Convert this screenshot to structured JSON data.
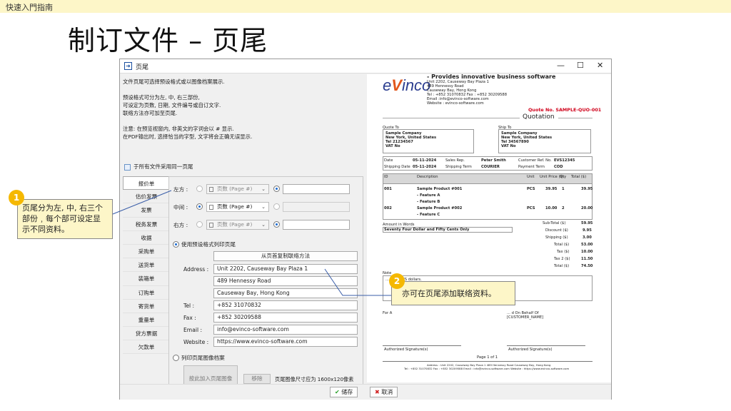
{
  "slide": {
    "header": "快速入門指南",
    "title": "制订文件 – 页尾"
  },
  "window": {
    "title": "页尾",
    "min": "—",
    "max": "☐",
    "close": "✕"
  },
  "notes": [
    "文件页尾可选择预设格式或以图像档案展示.",
    "",
    "预设格式可分为左, 中, 右三部份,",
    "可设定为页数, 日期, 文件编号或自订文字.",
    "联络方法亦可加至页尾.",
    "",
    "注意: 在预览视窗内, 非英文的字词会以 # 显示.",
    "在PDF输出时, 选择恰当的字型, 文字将会正确无误显示."
  ],
  "checkbox": "于所有文件采用同一页尾",
  "tabs": [
    "报价单",
    "估价发票",
    "发票",
    "税务发票",
    "收据",
    "采购单",
    "送货单",
    "装箱单",
    "订购单",
    "寄货单",
    "重量单",
    "贷方票据",
    "欠款单"
  ],
  "sections": {
    "left": "左方 :",
    "center": "中间 :",
    "right": "右方 :",
    "page_placeholder": "页数 (Page #)",
    "use_preset": "使用预设格式列印页尾",
    "copy_btn": "从页首复制联络方法",
    "address_label": "Address :",
    "address": [
      "Unit 2202, Causeway Bay Plaza 1",
      "489 Hennessy Road",
      "Causeway Bay, Hong Kong"
    ],
    "tel_label": "Tel :",
    "tel": "+852 31070832",
    "fax_label": "Fax :",
    "fax": "+852 30209588",
    "email_label": "Email :",
    "email": "info@evinco-software.com",
    "website_label": "Website :",
    "website": "https://www.evinco-software.com",
    "print_image": "列印页尾图像档案",
    "add_image_btn": "按此加入页尾图像",
    "remove_btn": "移除",
    "image_hint": "页尾图像尺寸应为 1600x120像素"
  },
  "buttons": {
    "save": "储存",
    "cancel": "取消"
  },
  "callouts": {
    "one_num": "1",
    "one": "页尾分为左, 中, 右三个部份﹐每个部可设定显示不同资料。",
    "two_num": "2",
    "two": "亦可在页尾添加联络资料。"
  },
  "preview": {
    "logo_a": "e",
    "logo_b": "V",
    "logo_c": "inco",
    "tagline": "- Provides innovative business software",
    "addr": [
      "Unit 2202, Causeway Bay Plaza 1",
      "489 Hennessy Road",
      "Causeway Bay, Hong Kong",
      "Tel : +852 31070832        Fax : +852 30209588",
      "Email :info@evinco-software.com",
      "Website : evinco-software.com"
    ],
    "quote_no": "Quote No. SAMPLE-QUO-001",
    "doc_title": "Quotation",
    "quote_to": "Quote To",
    "ship_to": "Ship To",
    "company": [
      "Sample Company",
      "New York, United States",
      "Tel 21234567",
      "VAT No"
    ],
    "ship": [
      "Sample Company",
      "New York, United States",
      "Tel 34567890",
      "VAT No"
    ],
    "info_row1": [
      "Date",
      "05-11-2024",
      "Sales Rep.",
      "Peter Smith",
      "Customer Ref. No.",
      "EVS12345"
    ],
    "info_row2": [
      "Shipping Date",
      "05-11-2024",
      "Shipping Term",
      "COURIER",
      "Payment Term",
      "COD"
    ],
    "item_head": [
      "ID",
      "Description",
      "Unit",
      "Unit Price ($)",
      "Qty",
      "Total ($)"
    ],
    "items": [
      [
        "001",
        "Sample Product #001",
        "PCS",
        "39.95",
        "1",
        "39.95"
      ],
      [
        "",
        "- Feature A",
        "",
        "",
        "",
        ""
      ],
      [
        "",
        "- Feature B",
        "",
        "",
        "",
        ""
      ],
      [
        "002",
        "Sample Product #002",
        "PCS",
        "10.00",
        "2",
        "20.00"
      ],
      [
        "",
        "- Feature C",
        "",
        "",
        "",
        ""
      ]
    ],
    "amount_words_label": "Amount in Words",
    "amount_words": "Seventy Four Dollar and Fifty Cents Only",
    "totals": [
      [
        "Sub-Total ($)",
        "59.95"
      ],
      [
        "Discount ($)",
        "9.95"
      ],
      [
        "Shipping ($)",
        "3.00"
      ],
      [
        "Total ($)",
        "53.00"
      ],
      [
        "Tax ($)",
        "10.00"
      ],
      [
        "Tax 2 ($)",
        "11.50"
      ],
      [
        "Total ($)",
        "74.50"
      ]
    ],
    "notes_label": "Note",
    "notes_text": "... are in US dollars.",
    "for_left": "For A",
    "for_right": "... d On Behalf Of",
    "for_right2": "[CUSTOMER_NAME]",
    "auth1": "Authorized Signature(s)",
    "auth2": "Authorized Signature(s)",
    "page": "Page 1 of 1",
    "footer1": "Address : Unit 2202, Causeway Bay Plaza 1 489 Hennessy Road Causeway Bay, Hong Kong",
    "footer2": "Tel : +852 31070832   Fax : +852 30209588   Email : info@evinco-software.com   Website : https://www.evinco-software.com"
  }
}
